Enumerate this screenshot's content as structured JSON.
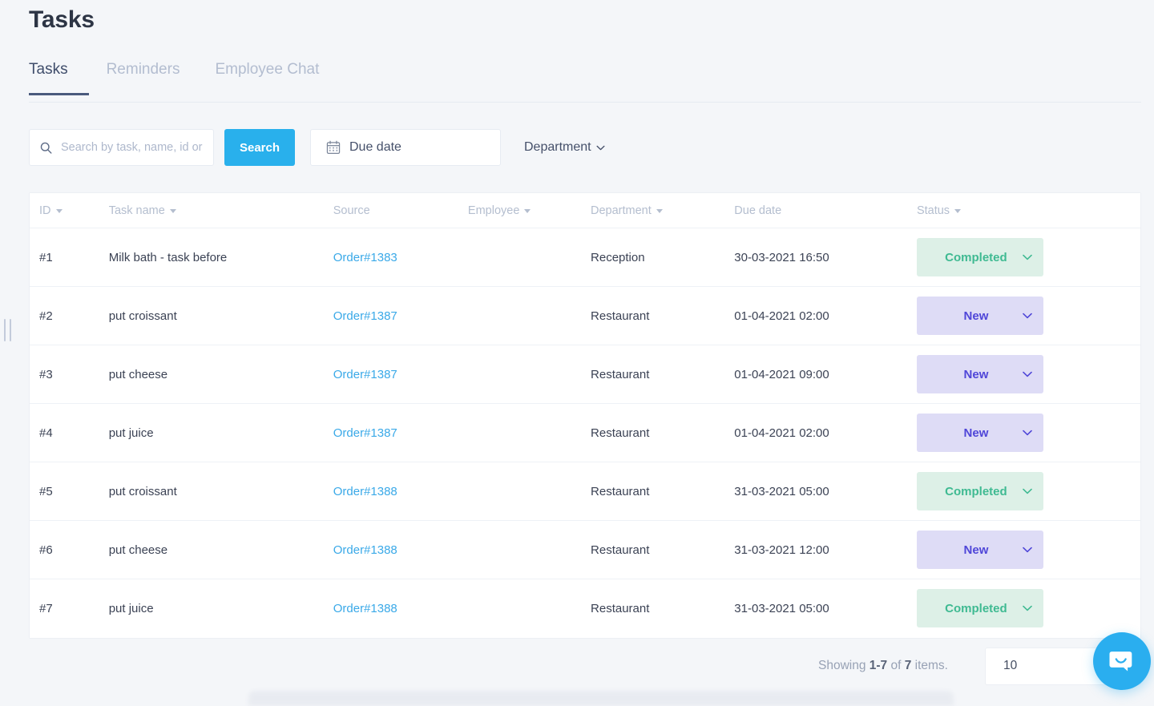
{
  "header": {
    "title": "Tasks"
  },
  "tabs": [
    {
      "label": "Tasks",
      "active": true
    },
    {
      "label": "Reminders",
      "active": false
    },
    {
      "label": "Employee Chat",
      "active": false
    }
  ],
  "filters": {
    "search_placeholder": "Search by task, name, id or",
    "search_value": "",
    "search_button": "Search",
    "due_date_label": "Due date",
    "department_label": "Department"
  },
  "table": {
    "columns": [
      {
        "label": "ID",
        "sortable": true
      },
      {
        "label": "Task name",
        "sortable": true
      },
      {
        "label": "Source",
        "sortable": false
      },
      {
        "label": "Employee",
        "sortable": true
      },
      {
        "label": "Department",
        "sortable": true
      },
      {
        "label": "Due date",
        "sortable": false
      },
      {
        "label": "Status",
        "sortable": true
      }
    ],
    "rows": [
      {
        "id": "#1",
        "task": "Milk bath - task before",
        "source": "Order#1383",
        "employee": "",
        "department": "Reception",
        "due": "30-03-2021 16:50",
        "status": "Completed",
        "status_kind": "completed"
      },
      {
        "id": "#2",
        "task": "put croissant",
        "source": "Order#1387",
        "employee": "",
        "department": "Restaurant",
        "due": "01-04-2021 02:00",
        "status": "New",
        "status_kind": "new"
      },
      {
        "id": "#3",
        "task": "put cheese",
        "source": "Order#1387",
        "employee": "",
        "department": "Restaurant",
        "due": "01-04-2021 09:00",
        "status": "New",
        "status_kind": "new"
      },
      {
        "id": "#4",
        "task": "put juice",
        "source": "Order#1387",
        "employee": "",
        "department": "Restaurant",
        "due": "01-04-2021 02:00",
        "status": "New",
        "status_kind": "new"
      },
      {
        "id": "#5",
        "task": "put croissant",
        "source": "Order#1388",
        "employee": "",
        "department": "Restaurant",
        "due": "31-03-2021 05:00",
        "status": "Completed",
        "status_kind": "completed"
      },
      {
        "id": "#6",
        "task": "put cheese",
        "source": "Order#1388",
        "employee": "",
        "department": "Restaurant",
        "due": "31-03-2021 12:00",
        "status": "New",
        "status_kind": "new"
      },
      {
        "id": "#7",
        "task": "put juice",
        "source": "Order#1388",
        "employee": "",
        "department": "Restaurant",
        "due": "31-03-2021 05:00",
        "status": "Completed",
        "status_kind": "completed"
      }
    ]
  },
  "footer": {
    "showing_prefix": "Showing ",
    "showing_range": "1-7",
    "showing_mid": " of ",
    "showing_total": "7",
    "showing_suffix": " items.",
    "page_size": "10"
  },
  "colors": {
    "accent": "#29b0ec",
    "link": "#3aa9e8",
    "tab_active": "#3f4d6b",
    "status_completed_bg": "#ddf0e7",
    "status_completed_fg": "#3fba92",
    "status_new_bg": "#dedcf6",
    "status_new_fg": "#4f46d8",
    "page_bg": "#f4f6f9"
  },
  "icons": {
    "search": "search-icon",
    "calendar": "calendar-icon",
    "chevron_down": "chevron-down-icon",
    "chat": "chat-bubble-icon"
  }
}
